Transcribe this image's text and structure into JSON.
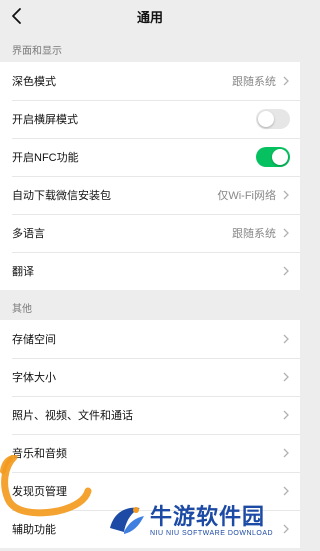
{
  "header": {
    "title": "通用",
    "back_icon": "chevron-left-icon"
  },
  "section_display": {
    "title": "界面和显示",
    "items": [
      {
        "label": "深色模式",
        "value": "跟随系统",
        "type": "link"
      },
      {
        "label": "开启横屏模式",
        "toggle": "off",
        "type": "toggle"
      },
      {
        "label": "开启NFC功能",
        "toggle": "on",
        "type": "toggle"
      },
      {
        "label": "自动下载微信安装包",
        "value": "仅Wi-Fi网络",
        "type": "link"
      },
      {
        "label": "多语言",
        "value": "跟随系统",
        "type": "link"
      },
      {
        "label": "翻译",
        "type": "link"
      }
    ]
  },
  "section_other": {
    "title": "其他",
    "items": [
      {
        "label": "存储空间",
        "type": "link"
      },
      {
        "label": "字体大小",
        "type": "link"
      },
      {
        "label": "照片、视频、文件和通话",
        "type": "link"
      },
      {
        "label": "音乐和音频",
        "type": "link"
      },
      {
        "label": "发现页管理",
        "type": "link"
      },
      {
        "label": "辅助功能",
        "type": "link"
      }
    ]
  },
  "watermark": {
    "text_cn": "牛游软件园",
    "text_en": "NIU NIU SOFTWARE DOWNLOAD"
  },
  "colors": {
    "toggle_on": "#07c160",
    "toggle_off": "#e6e6e6",
    "highlight": "#f39a1e",
    "watermark": "#1c4aa5"
  }
}
